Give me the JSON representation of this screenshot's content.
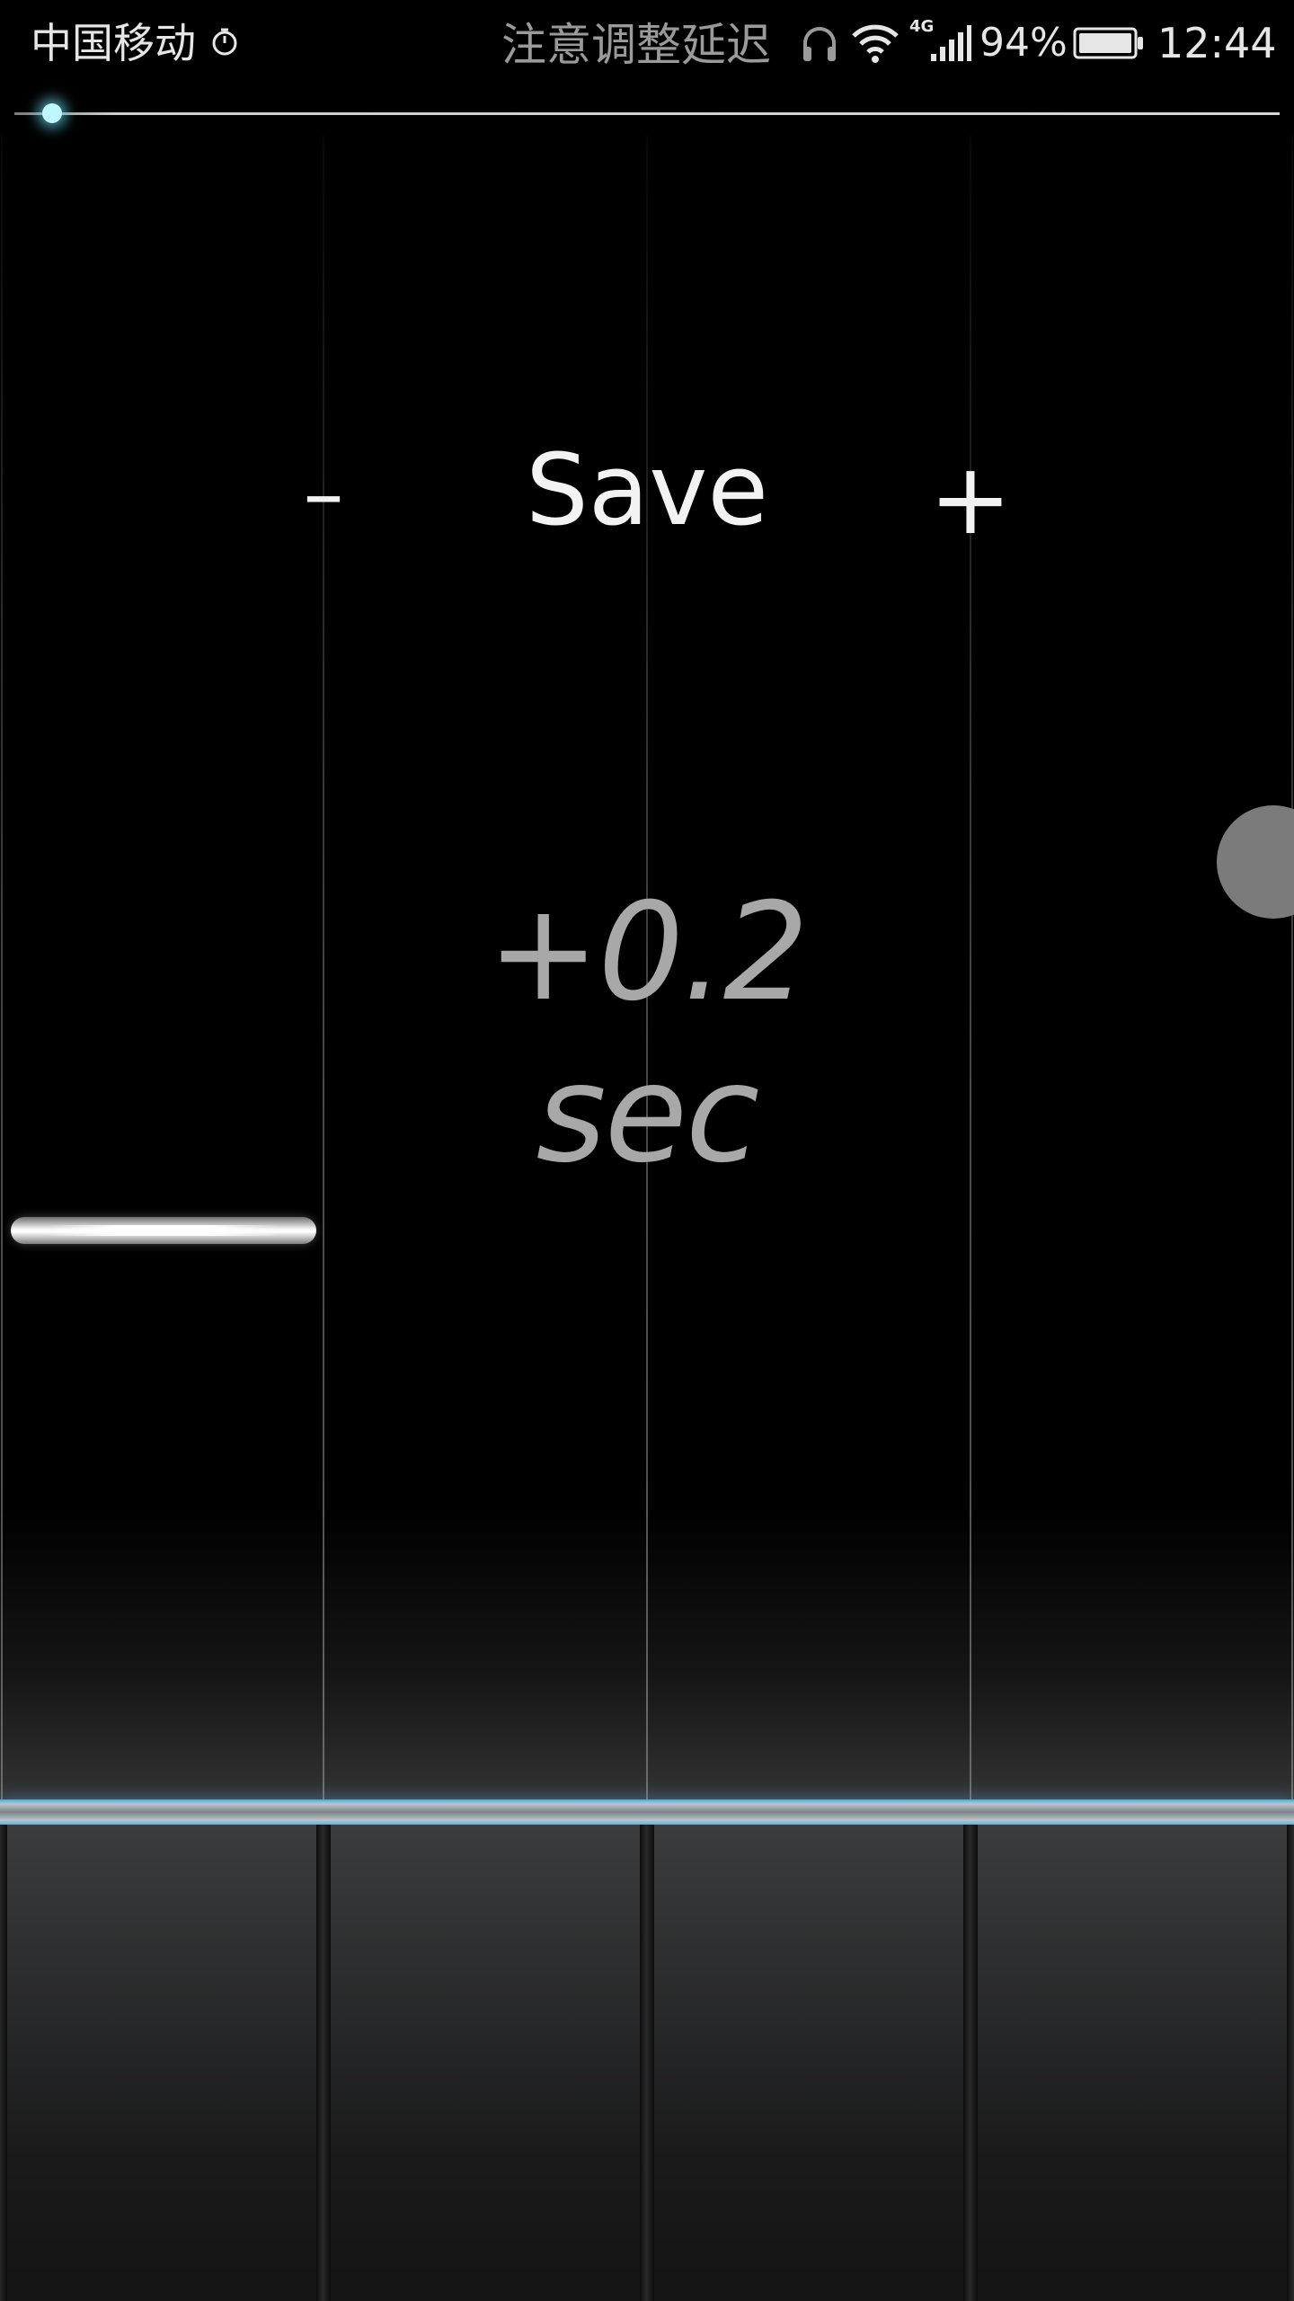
{
  "status_bar": {
    "carrier": "中国移动",
    "notification": "注意调整延迟",
    "network_type": "4G",
    "battery_percent": "94%",
    "time": "12:44",
    "icons": [
      "timer-icon",
      "headphones-icon",
      "wifi-icon",
      "signal-icon",
      "battery-icon"
    ]
  },
  "progress": {
    "fraction": 0.03
  },
  "controls": {
    "minus_label": "–",
    "save_label": "Save",
    "plus_label": "+"
  },
  "delay": {
    "value_text": "+0.2 sec"
  },
  "colors": {
    "accent": "#6ee6ff",
    "judgment_line": "#4fa9d8",
    "delay_text": "#a8a8a8"
  }
}
